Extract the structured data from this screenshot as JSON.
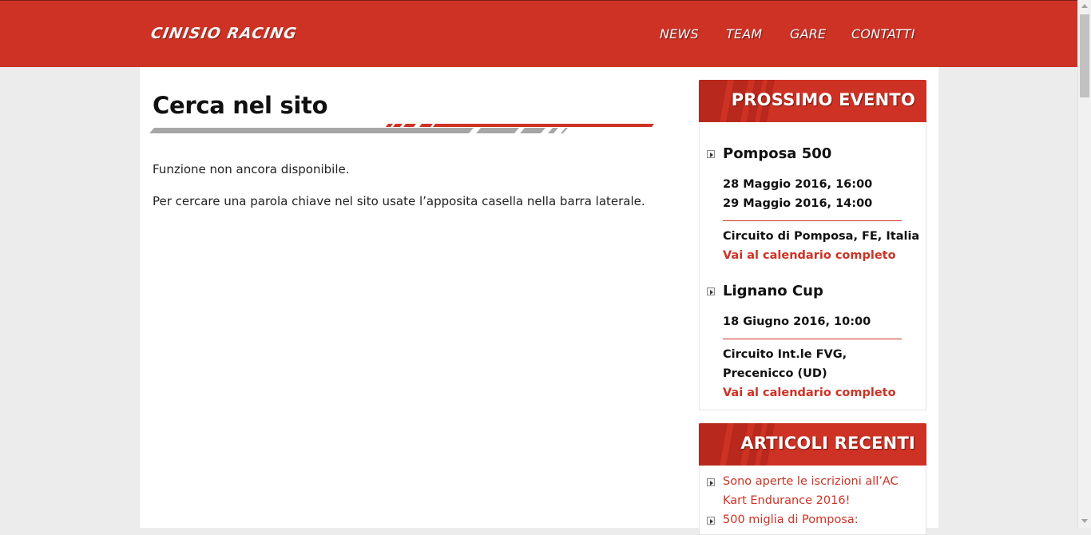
{
  "header": {
    "logo": "CINISIO RACING",
    "nav": [
      "NEWS",
      "TEAM",
      "GARE",
      "CONTATTI"
    ]
  },
  "main": {
    "title": "Cerca nel sito",
    "paragraphs": [
      "Funzione non ancora disponibile.",
      "Per cercare una parola chiave nel sito usate l’apposita casella nella barra laterale."
    ]
  },
  "sidebar": {
    "events": {
      "title": "PROSSIMO EVENTO",
      "items": [
        {
          "name": "Pomposa 500",
          "dates": [
            "28 Maggio 2016, 16:00",
            "29 Maggio 2016, 14:00"
          ],
          "location": [
            "Circuito di Pomposa, FE, Italia"
          ],
          "link": "Vai al calendario completo"
        },
        {
          "name": "Lignano Cup",
          "dates": [
            "18 Giugno 2016, 10:00"
          ],
          "location": [
            "Circuito Int.le FVG,",
            "Precenicco (UD)"
          ],
          "link": "Vai al calendario completo"
        }
      ]
    },
    "articles": {
      "title": "ARTICOLI RECENTI",
      "items": [
        {
          "lines": [
            "Sono aperte le iscrizioni all’AC",
            "Kart Endurance 2016!"
          ]
        },
        {
          "lines": [
            "500 miglia di Pomposa:"
          ]
        }
      ]
    }
  },
  "colors": {
    "brand_red": "#cd3224",
    "page_bg": "#ececec"
  },
  "icons": {
    "list_bullet": "play-bullet-icon"
  }
}
